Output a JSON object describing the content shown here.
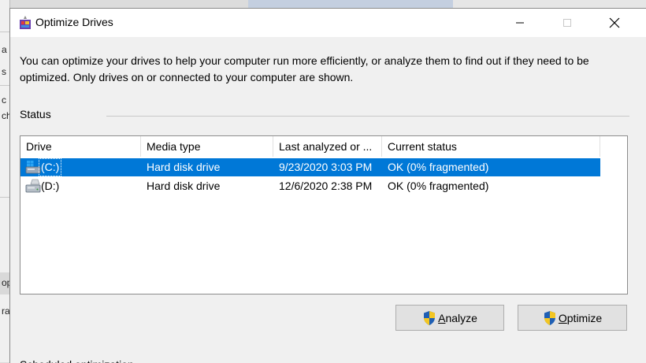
{
  "background_window": {
    "fragments": [
      "a",
      "s S",
      "c",
      "ch",
      "op",
      "ra"
    ]
  },
  "window": {
    "title": "Optimize Drives",
    "minimize_glyph": "—",
    "maximize_glyph": "☐",
    "close_glyph": "✕"
  },
  "description": "You can optimize your drives to help your computer run more efficiently, or analyze them to find out if they need to be optimized. Only drives on or connected to your computer are shown.",
  "status_section": {
    "label": "Status",
    "columns": [
      "Drive",
      "Media type",
      "Last analyzed or ...",
      "Current status"
    ],
    "drives": [
      {
        "drive": "(C:)",
        "media_type": "Hard disk drive",
        "last_analyzed": "9/23/2020 3:03 PM",
        "status": "OK (0% fragmented)",
        "selected": true
      },
      {
        "drive": "(D:)",
        "media_type": "Hard disk drive",
        "last_analyzed": "12/6/2020 2:38 PM",
        "status": "OK (0% fragmented)",
        "selected": false
      }
    ]
  },
  "buttons": {
    "analyze_accel": "A",
    "analyze_rest": "nalyze",
    "optimize_accel": "O",
    "optimize_rest": "ptimize"
  },
  "scheduled_section": {
    "label": "Scheduled optimization"
  },
  "colors": {
    "selection": "#0078d7",
    "window_bg": "#f0f0f0"
  }
}
